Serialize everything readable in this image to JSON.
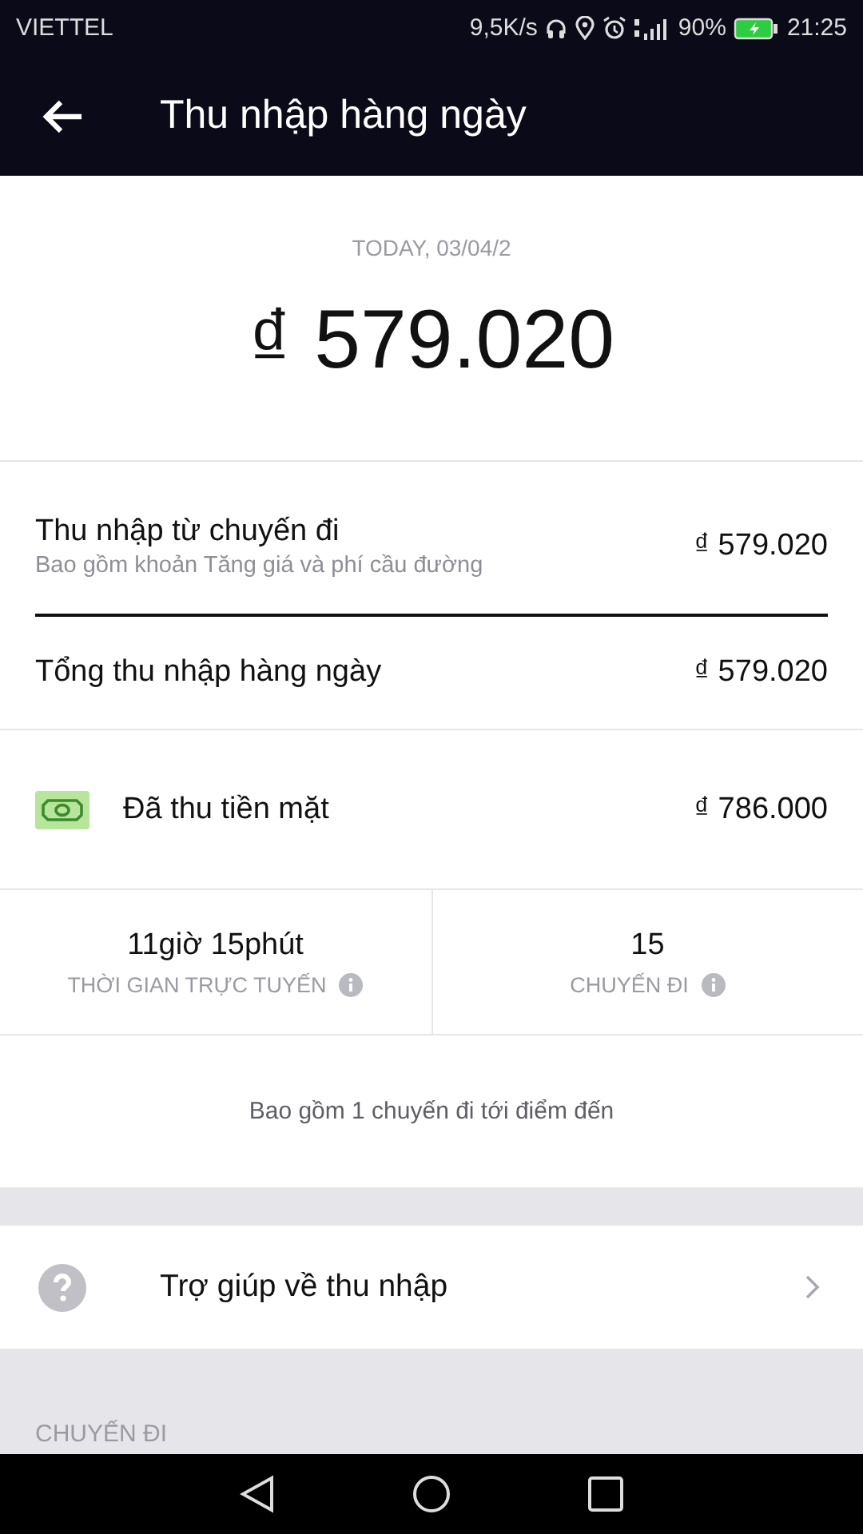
{
  "status_bar": {
    "carrier": "VIETTEL",
    "speed": "9,5K/s",
    "battery": "90%",
    "time": "21:25"
  },
  "header": {
    "title": "Thu nhập hàng ngày"
  },
  "summary": {
    "date": "TODAY, 03/04/2",
    "amount": "₫ 579.020"
  },
  "earnings": [
    {
      "label": "Thu nhập từ chuyến đi",
      "sublabel": "Bao gồm khoản Tăng giá và phí cầu đường",
      "value": "₫ 579.020"
    },
    {
      "label": "Tổng thu nhập hàng ngày",
      "value": "₫ 579.020"
    }
  ],
  "cash": {
    "label": "Đã thu tiền mặt",
    "value": "₫ 786.000"
  },
  "stats": [
    {
      "value": "11giờ 15phút",
      "label": "THỜI GIAN TRỰC TUYẾN"
    },
    {
      "value": "15",
      "label": "CHUYẾN ĐI"
    }
  ],
  "note": "Bao gồm 1 chuyến đi tới điểm đến",
  "help": {
    "label": "Trợ giúp về thu nhập"
  },
  "section_heading": "CHUYẾN ĐI"
}
